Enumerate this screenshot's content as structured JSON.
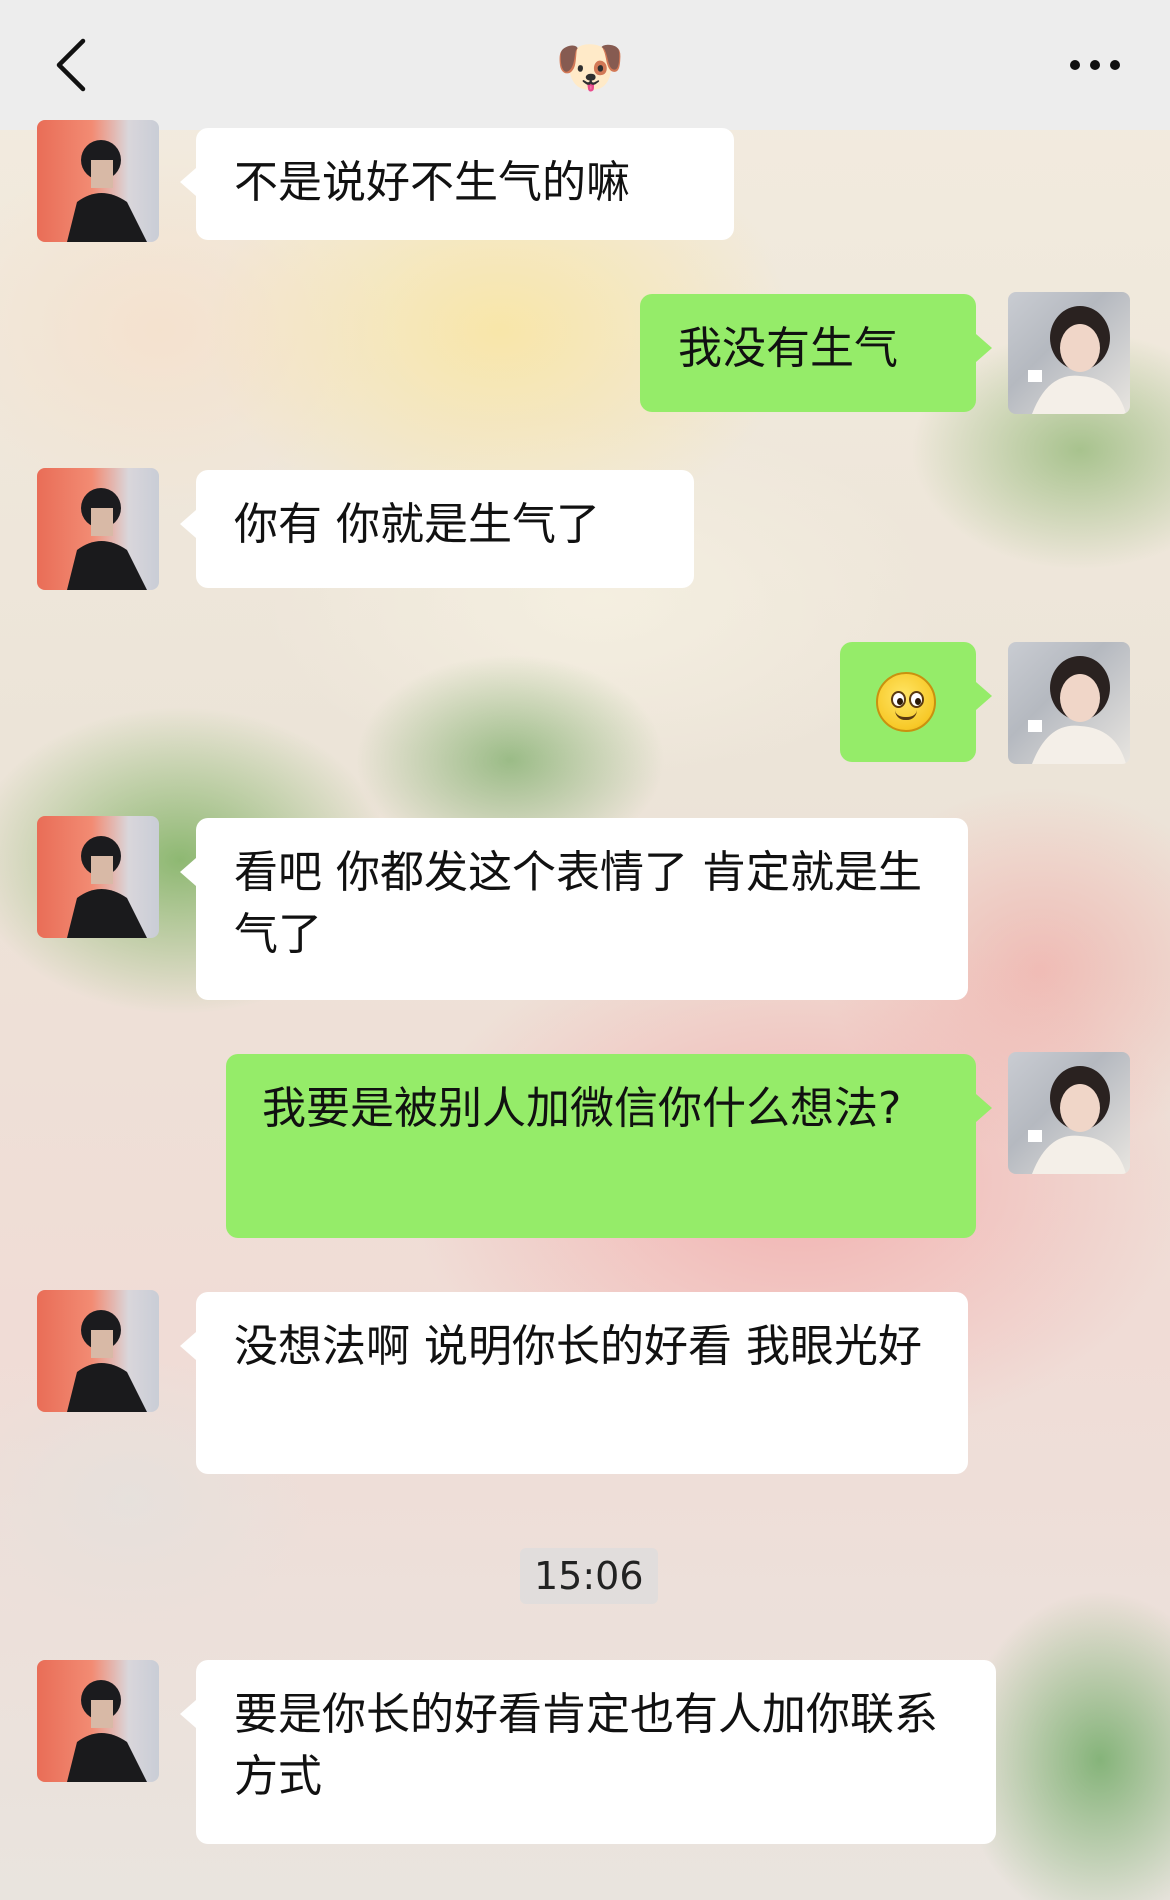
{
  "header": {
    "back_icon": "chevron-left-icon",
    "title_emoji": "🐶",
    "more_icon": "ellipsis-icon"
  },
  "messages": [
    {
      "side": "left",
      "text": "不是说好不生气的嘛"
    },
    {
      "side": "right",
      "text": "我没有生气"
    },
    {
      "side": "left",
      "text": "你有 你就是生气了"
    },
    {
      "side": "right",
      "emoji": "smiley-icon"
    },
    {
      "side": "left",
      "text": "看吧 你都发这个表情了 肯定就是生气了"
    },
    {
      "side": "right",
      "text": "我要是被别人加微信你什么想法?"
    },
    {
      "side": "left",
      "text": "没想法啊 说明你长的好看 我眼光好"
    },
    {
      "side": "left",
      "text": "要是你长的好看肯定也有人加你联系方式"
    }
  ],
  "timestamp": "15:06",
  "colors": {
    "sent_bubble": "#95ec69",
    "received_bubble": "#ffffff",
    "topbar": "#ededed"
  }
}
